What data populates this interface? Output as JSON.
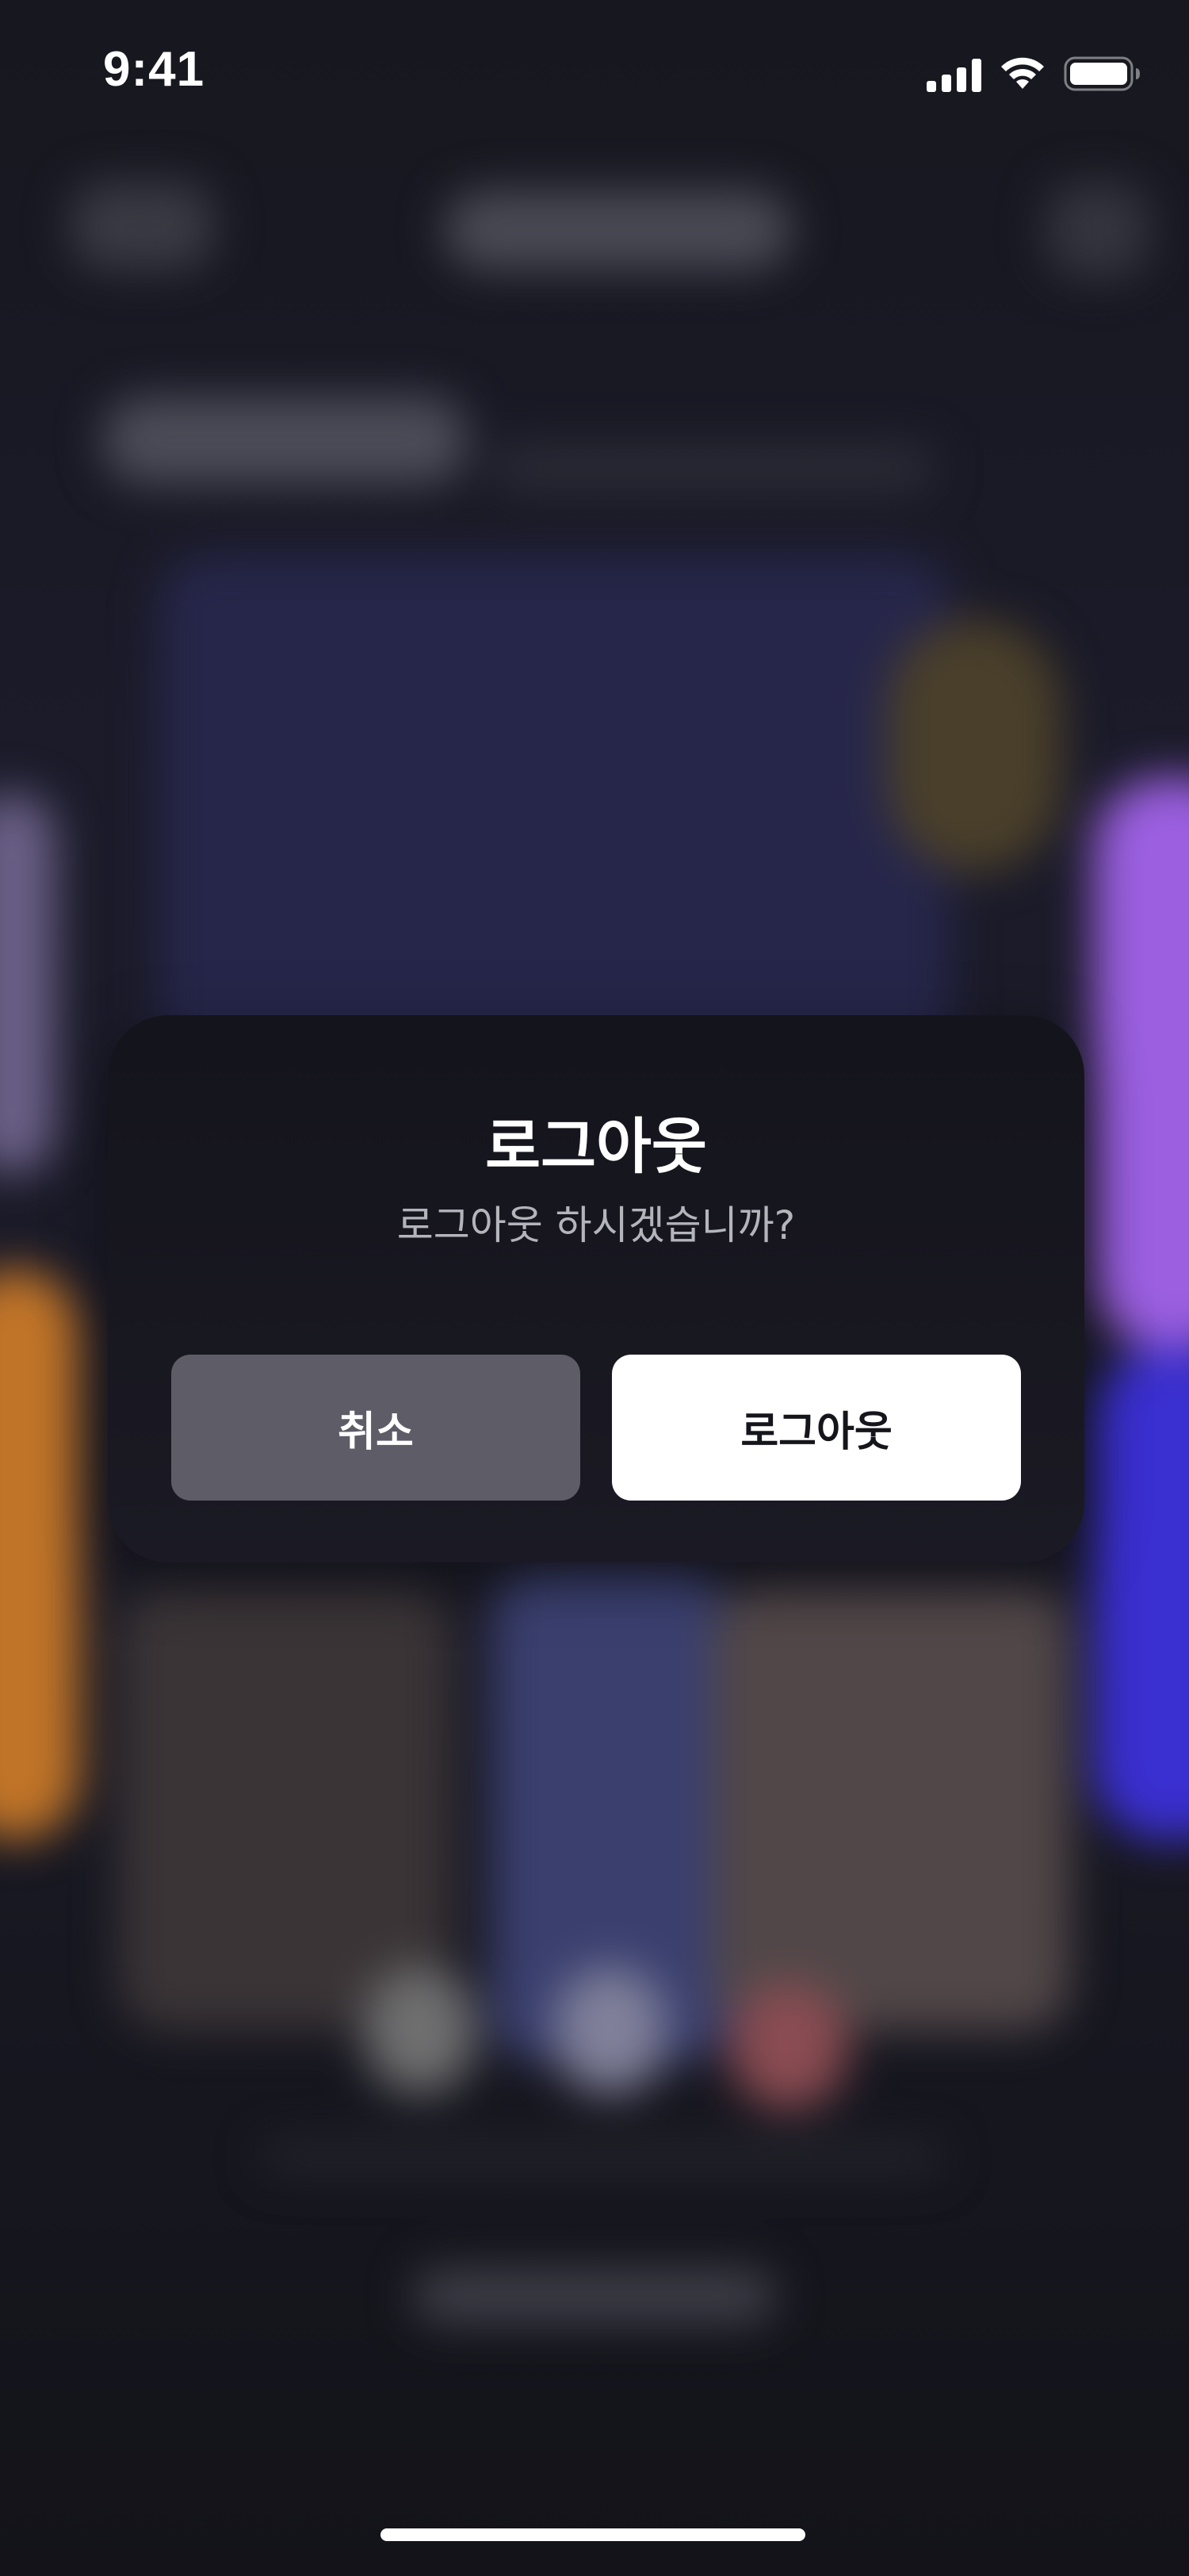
{
  "status_bar": {
    "time": "9:41",
    "icons": [
      "cellular-signal-icon",
      "wifi-icon",
      "battery-icon"
    ]
  },
  "dialog": {
    "title": "로그아웃",
    "message": "로그아웃 하시겠습니까?",
    "cancel_label": "취소",
    "confirm_label": "로그아웃"
  },
  "colors": {
    "dialog_background": "#1a1922",
    "cancel_button": "#5d5c67",
    "confirm_button": "#ffffff",
    "title_text": "#ffffff",
    "message_text": "#b4b4bb"
  }
}
